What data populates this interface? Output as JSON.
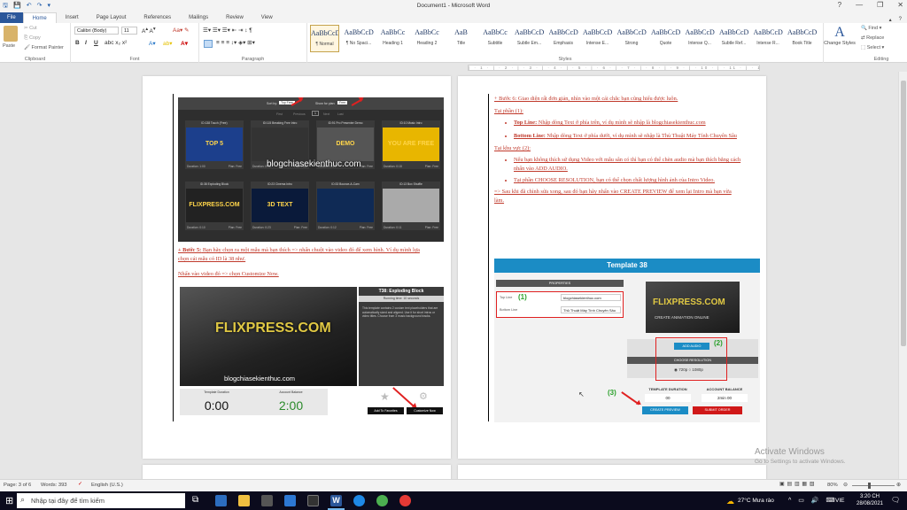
{
  "window": {
    "title": "Document1 - Microsoft Word"
  },
  "tabs": [
    {
      "label": "File"
    },
    {
      "label": "Home"
    },
    {
      "label": "Insert"
    },
    {
      "label": "Page Layout"
    },
    {
      "label": "References"
    },
    {
      "label": "Mailings"
    },
    {
      "label": "Review"
    },
    {
      "label": "View"
    }
  ],
  "ribbon": {
    "clipboard": {
      "paste": "Paste",
      "cut": "Cut",
      "copy": "Copy",
      "format_painter": "Format Painter",
      "group": "Clipboard"
    },
    "font": {
      "name": "Calibri (Body)",
      "size": "11",
      "group": "Font"
    },
    "paragraph": {
      "group": "Paragraph"
    },
    "styles": {
      "group": "Styles",
      "items": [
        {
          "preview": "AaBbCcDc",
          "name": "¶ Normal"
        },
        {
          "preview": "AaBbCcDc",
          "name": "¶ No Spaci..."
        },
        {
          "preview": "AaBbCc",
          "name": "Heading 1"
        },
        {
          "preview": "AaBbCc",
          "name": "Heading 2"
        },
        {
          "preview": "AaB",
          "name": "Title"
        },
        {
          "preview": "AaBbCc",
          "name": "Subtitle"
        },
        {
          "preview": "AaBbCcDc",
          "name": "Subtle Em..."
        },
        {
          "preview": "AaBbCcDc",
          "name": "Emphasis"
        },
        {
          "preview": "AaBbCcDc",
          "name": "Intense E..."
        },
        {
          "preview": "AaBbCcDc",
          "name": "Strong"
        },
        {
          "preview": "AaBbCcDc",
          "name": "Quote"
        },
        {
          "preview": "AaBbCcDc",
          "name": "Intense Q..."
        },
        {
          "preview": "AaBbCcDc",
          "name": "Subtle Ref..."
        },
        {
          "preview": "AaBbCcDc",
          "name": "Intense R..."
        },
        {
          "preview": "AaBbCcDc",
          "name": "Book Title"
        }
      ],
      "change_styles": "Change Styles"
    },
    "editing": {
      "find": "Find",
      "replace": "Replace",
      "select": "Select",
      "group": "Editing"
    }
  },
  "page1": {
    "sortbar": {
      "sort_by": "Sort by:",
      "sort_val": "Top Free",
      "show_for": "Show for plan:",
      "show_val": "Free"
    },
    "pager": {
      "first": "First",
      "prev": "Previous",
      "num": "1",
      "next": "Next",
      "last": "Last"
    },
    "tiles": [
      {
        "title": "ID:138 Touch (Free)",
        "duration": "Duration: 1:00",
        "plan": "Plan: Free",
        "text": "TOP 5"
      },
      {
        "title": "ID:115 Breaking Free Intro",
        "duration": "Duration: 0:36",
        "plan": "Plan: Free",
        "text": ""
      },
      {
        "title": "ID:91 Pro Presenter Demo",
        "duration": "Duration: 0:22",
        "plan": "Plan: Free",
        "text": "DEMO"
      },
      {
        "title": "ID:10 Music Intro",
        "duration": "Duration: 0:18",
        "plan": "Plan: Free",
        "text": "YOU ARE FREE"
      },
      {
        "title": "ID:38 Exploding Block",
        "duration": "Duration: 0:10",
        "plan": "Plan: Free",
        "text": "FLIXPRESS.COM"
      },
      {
        "title": "ID:23 Cinema Intro",
        "duration": "Duration: 0:23",
        "plan": "Plan: Free",
        "text": "3D TEXT"
      },
      {
        "title": "ID:33 Bounce-A-Cam",
        "duration": "Duration: 0:12",
        "plan": "Plan: Free",
        "text": ""
      },
      {
        "title": "ID:13 Box Shuffle",
        "duration": "Duration: 0:11",
        "plan": "Plan: Free",
        "text": ""
      }
    ],
    "watermark": "blogchiasekienthuc.com",
    "step5_prefix": "+ Bước 5:",
    "step5_text": " Bạn hãy chọn ra một mẫu mà bạn thích => nhấn chuột vào video đó để xem hình. Ví dụ mình lựa chọn cái mẫu có ID là 38 như.",
    "step5_next": "Nhấn vào video đó => chọn Customize Now.",
    "preview": {
      "video_text": "FLIXPRESS.COM",
      "watermark": "blogchiasekienthuc.com",
      "panel_title": "T38: Exploding Block",
      "running_time": "Running time: 10 seconds",
      "desc": "This template contains 2 custom text placeholders that are automatically sized and aligned. Use it for short intros or video titles. Choose from 3 music background tracks.",
      "template_duration_label": "Template Duration",
      "template_duration": "0:00",
      "account_balance_label": "Account Balance",
      "account_balance": "2:00",
      "add_fav": "Add To Favorites",
      "customize": "Customize Now"
    }
  },
  "page2": {
    "step6": "+ Bước 6: Giao diện rất đơn giản, nhìn vào một cái chắc bạn cũng hiểu được luôn.",
    "section1": "Tại phần (1):",
    "b1_label": "Top Line:",
    "b1_text": " Nhập dòng Text ở phía trên, ví dụ mình sẽ nhập là blogchiasekienthuc.com",
    "b2_label": "Bottom Line:",
    "b2_text": " Nhập dòng Text ở phía dưới, ví dụ mình sẽ nhập là Thủ Thuật Máy Tính Chuyên Sâu",
    "section2": "Tại khu vực (2):",
    "b3": "Nếu bạn không thích sử dụng Video với mẫu sẵn có thì bạn có thể chèn audio mà bạn thích bằng cách nhấn vào ADD AUDIO.",
    "b4": "Tại phần CHOOSE RESOLUTION, bạn có thể chọn chất lượng hình ảnh của Intro Video.",
    "final": "=> Sau khi đã chỉnh sửa xong, sau đó bạn hãy nhấn vào CREATE PREVIEW để xem lại Intro mà bạn vừa làm.",
    "template": {
      "title": "Template 38",
      "properties": "PROPERTIES",
      "top_line_label": "Top Line",
      "top_line_value": "blogchiasekienthuc.com",
      "bottom_line_label": "Bottom Line",
      "bottom_line_value": "Thủ Thuật Máy Tính Chuyên Sâu",
      "marker1": "(1)",
      "marker2": "(2)",
      "marker3": "(3)",
      "thumb_text": "FLIXPRESS.COM",
      "thumb_sub": "CREATE ANIMATION ONLINE",
      "add_audio": "ADD AUDIO",
      "choose_res": "CHOOSE RESOLUTION",
      "res720": "720p",
      "res1080": "1080p",
      "template_duration_label": "TEMPLATE DURATION",
      "template_duration": "00",
      "account_balance_label": "ACCOUNT BALANCE",
      "account_balance": "2min 00",
      "create_preview": "CREATE PREVIEW",
      "submit_order": "SUBMIT ORDER"
    }
  },
  "activation": {
    "line1": "Activate Windows",
    "line2": "Go to Settings to activate Windows."
  },
  "status": {
    "page": "Page: 3 of 6",
    "words": "Words: 393",
    "lang": "English (U.S.)",
    "zoom": "80%"
  },
  "taskbar": {
    "search_placeholder": "Nhập tại đây để tìm kiếm",
    "weather": "27°C  Mưa rào",
    "lang": "VIE",
    "time": "3:20 CH",
    "date": "28/08/2021"
  }
}
